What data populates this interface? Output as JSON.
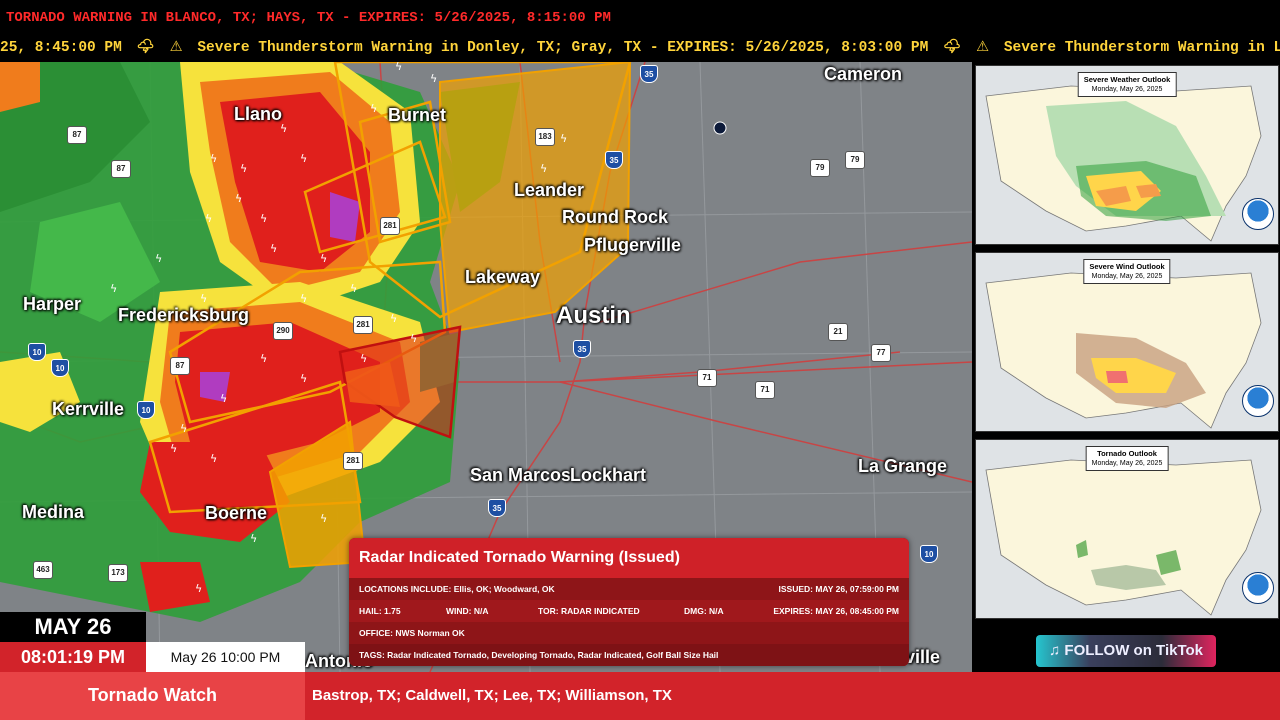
{
  "top_alert": "TORNADO WARNING IN BLANCO, TX; HAYS, TX - EXPIRES: 5/26/2025, 8:15:00 PM",
  "ticker": {
    "lead": "25, 8:45:00 PM",
    "item1": "Severe Thunderstorm Warning in Donley, TX; Gray, TX - EXPIRES: 5/26/2025, 8:03:00 PM",
    "item2": "Severe Thunderstorm Warning in L",
    "storm_icon": "🌩",
    "warn_icon": "⚠"
  },
  "map": {
    "cities": {
      "cameron": "Cameron",
      "llano": "Llano",
      "burnet": "Burnet",
      "leander": "Leander",
      "round_rock": "Round Rock",
      "pflugerville": "Pflugerville",
      "lakeway": "Lakeway",
      "austin": "Austin",
      "harper": "Harper",
      "fredericksburg": "Fredericksburg",
      "kerrville": "Kerrville",
      "san_marcos": "San Marcos",
      "lockhart": "Lockhart",
      "la_grange": "La Grange",
      "medina": "Medina",
      "boerne": "Boerne",
      "antonio": "Antonio",
      "ville": "ville"
    },
    "shields": {
      "s87a": "87",
      "s87b": "87",
      "s183": "183",
      "s79": "79",
      "s79b": "79",
      "s281": "281",
      "s281b": "281",
      "s281c": "281",
      "s290": "290",
      "s87c": "87",
      "s21": "21",
      "s77": "77",
      "s71": "71",
      "s71b": "71",
      "s173": "173",
      "s463": "463",
      "i35a": "35",
      "i35b": "35",
      "i35c": "35",
      "i35d": "35",
      "i10a": "10",
      "i10b": "10",
      "i10c": "10",
      "i10d": "10"
    }
  },
  "outlooks": {
    "severe": {
      "title": "Severe Weather Outlook",
      "date": "Monday, May 26, 2025"
    },
    "wind": {
      "title": "Severe Wind Outlook",
      "date": "Monday, May 26, 2025"
    },
    "tornado": {
      "title": "Tornado Outlook",
      "date": "Monday, May 26, 2025"
    }
  },
  "tiktok": {
    "icon": "♫",
    "label": "FOLLOW on TikTok"
  },
  "alert_card": {
    "title": "Radar Indicated Tornado Warning (Issued)",
    "locations": "LOCATIONS INCLUDE: Ellis, OK; Woodward, OK",
    "issued": "ISSUED: MAY 26, 07:59:00 PM",
    "hail": "HAIL: 1.75",
    "wind": "WIND: N/A",
    "tor": "TOR: RADAR INDICATED",
    "dmg": "DMG: N/A",
    "expires": "EXPIRES: MAY 26, 08:45:00 PM",
    "office": "OFFICE: NWS Norman OK",
    "tags": "TAGS: Radar Indicated Tornado, Developing Tornado, Radar Indicated, Golf Ball Size Hail"
  },
  "clock": {
    "date": "MAY 26",
    "time": "08:01:19 PM",
    "next": "May 26 10:00 PM"
  },
  "watch": {
    "title": "Tornado Watch",
    "areas": "Bastrop, TX; Caldwell, TX; Lee, TX; Williamson, TX"
  },
  "colors": {
    "warning_red": "#d2232a",
    "watch_orange": "#f2a100",
    "ticker_yellow": "#ffd43b"
  }
}
